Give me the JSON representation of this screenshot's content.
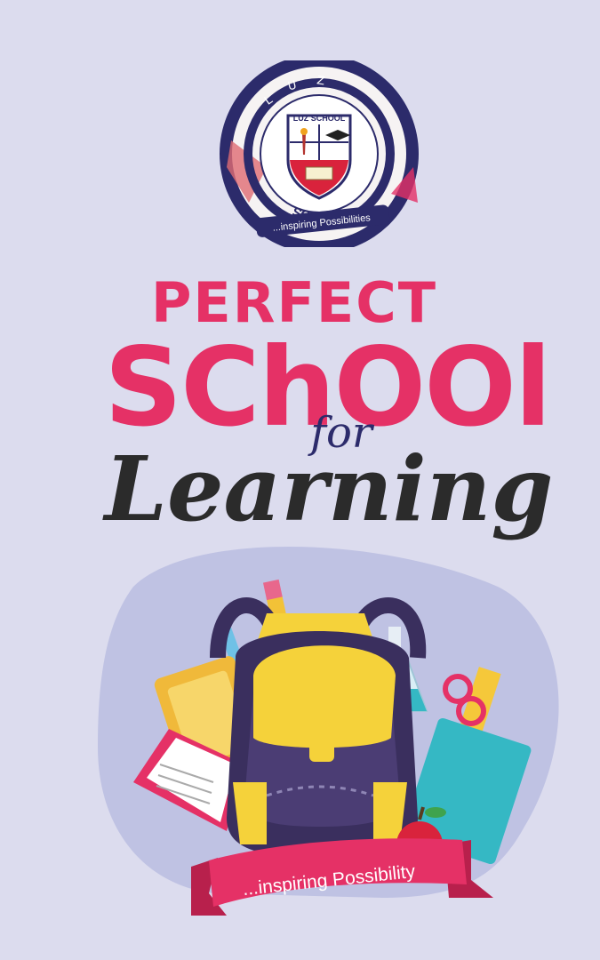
{
  "logo": {
    "ring_letters": [
      "L",
      "U",
      "Z"
    ],
    "shield_title": "LUZ SCHOOL",
    "bottom_text": "SCHOOL",
    "tagline": "...inspiring Possibilities"
  },
  "headline": {
    "line1": "PERFECT",
    "line2": "SChOOl",
    "line3": "for",
    "line4": "Learning"
  },
  "banner": {
    "text": "...inspiring Possibility"
  },
  "colors": {
    "background": "#dcdcee",
    "pink": "#e53166",
    "dark": "#2b2b2b",
    "navy": "#2c2b6b",
    "yellow": "#f5d23a",
    "purple": "#3a2f5e",
    "teal": "#35b8c4"
  }
}
